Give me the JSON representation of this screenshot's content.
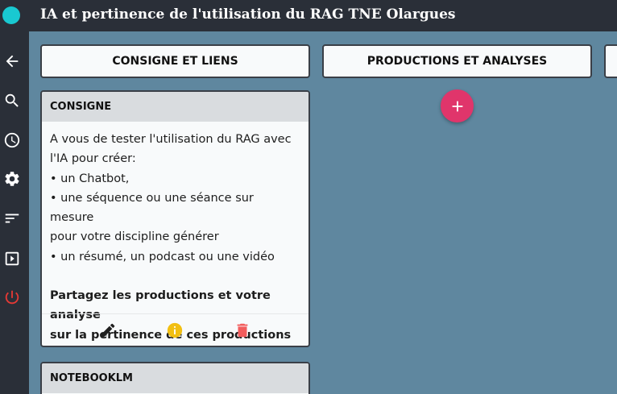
{
  "app": {
    "title": "IA et pertinence de l'utilisation du RAG TNE Olargues"
  },
  "sidebar": {
    "items": [
      {
        "icon": "arrow-left-icon"
      },
      {
        "icon": "search-icon"
      },
      {
        "icon": "clock-icon"
      },
      {
        "icon": "gear-icon"
      },
      {
        "icon": "sort-icon"
      },
      {
        "icon": "slideshow-icon"
      },
      {
        "icon": "power-icon"
      }
    ]
  },
  "columns": [
    {
      "label": "CONSIGNE ET LIENS"
    },
    {
      "label": "PRODUCTIONS ET ANALYSES"
    }
  ],
  "cards": [
    {
      "title": "CONSIGNE",
      "lines": [
        "A vous de tester l'utilisation du RAG avec",
        "l'IA pour créer:",
        "• un Chatbot,",
        "• une séquence ou une séance sur mesure",
        "pour votre discipline générer",
        "• un résumé,  un podcast ou une vidéo"
      ],
      "bold_lines": [
        "Partagez les productions et votre analyse",
        "sur la pertinence de ces productions"
      ],
      "actions": [
        {
          "icon": "pencil-icon"
        },
        {
          "icon": "info-icon"
        },
        {
          "icon": "trash-icon"
        }
      ]
    },
    {
      "title": "NOTEBOOKLM"
    }
  ],
  "colors": {
    "background": "#5f879f",
    "topbar": "#2a2f38",
    "accent_add": "#e0356b",
    "logo": "#19c9d1",
    "info": "#f2bf12",
    "trash": "#f25c5c",
    "power": "#e53935"
  }
}
